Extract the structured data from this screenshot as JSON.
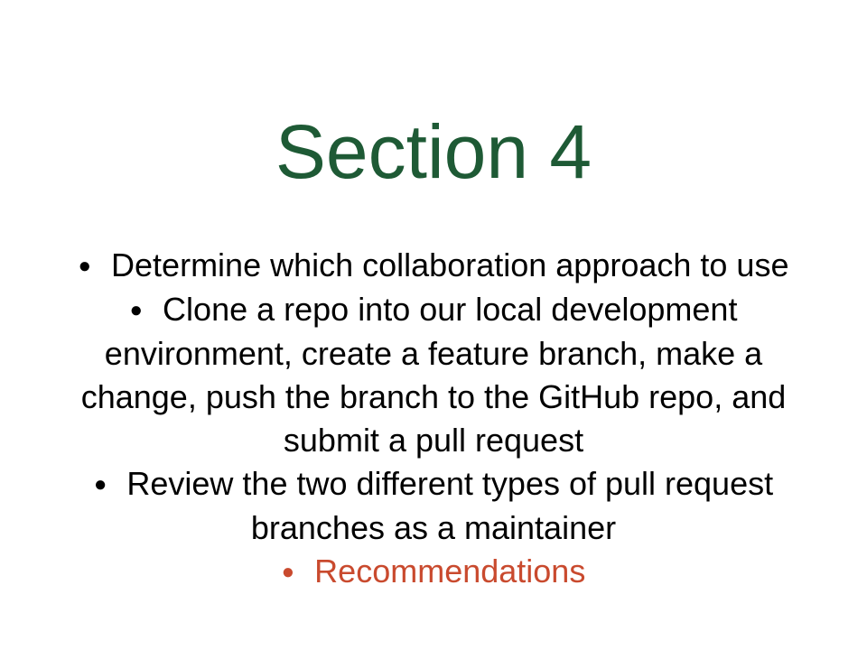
{
  "slide": {
    "title": "Section 4",
    "bullets": [
      {
        "text": "Determine which collaboration approach to use",
        "highlight": false
      },
      {
        "text": "Clone a repo into our local development environment, create a feature branch, make a change, push the branch to the GitHub repo, and submit a pull request",
        "highlight": false
      },
      {
        "text": "Review the two different types of pull request branches as a maintainer",
        "highlight": false
      },
      {
        "text": "Recommendations",
        "highlight": true
      }
    ],
    "bullet_glyph": "●"
  },
  "colors": {
    "title": "#1e5a35",
    "body_text": "#000000",
    "highlight": "#c94a2e",
    "background": "#ffffff"
  }
}
